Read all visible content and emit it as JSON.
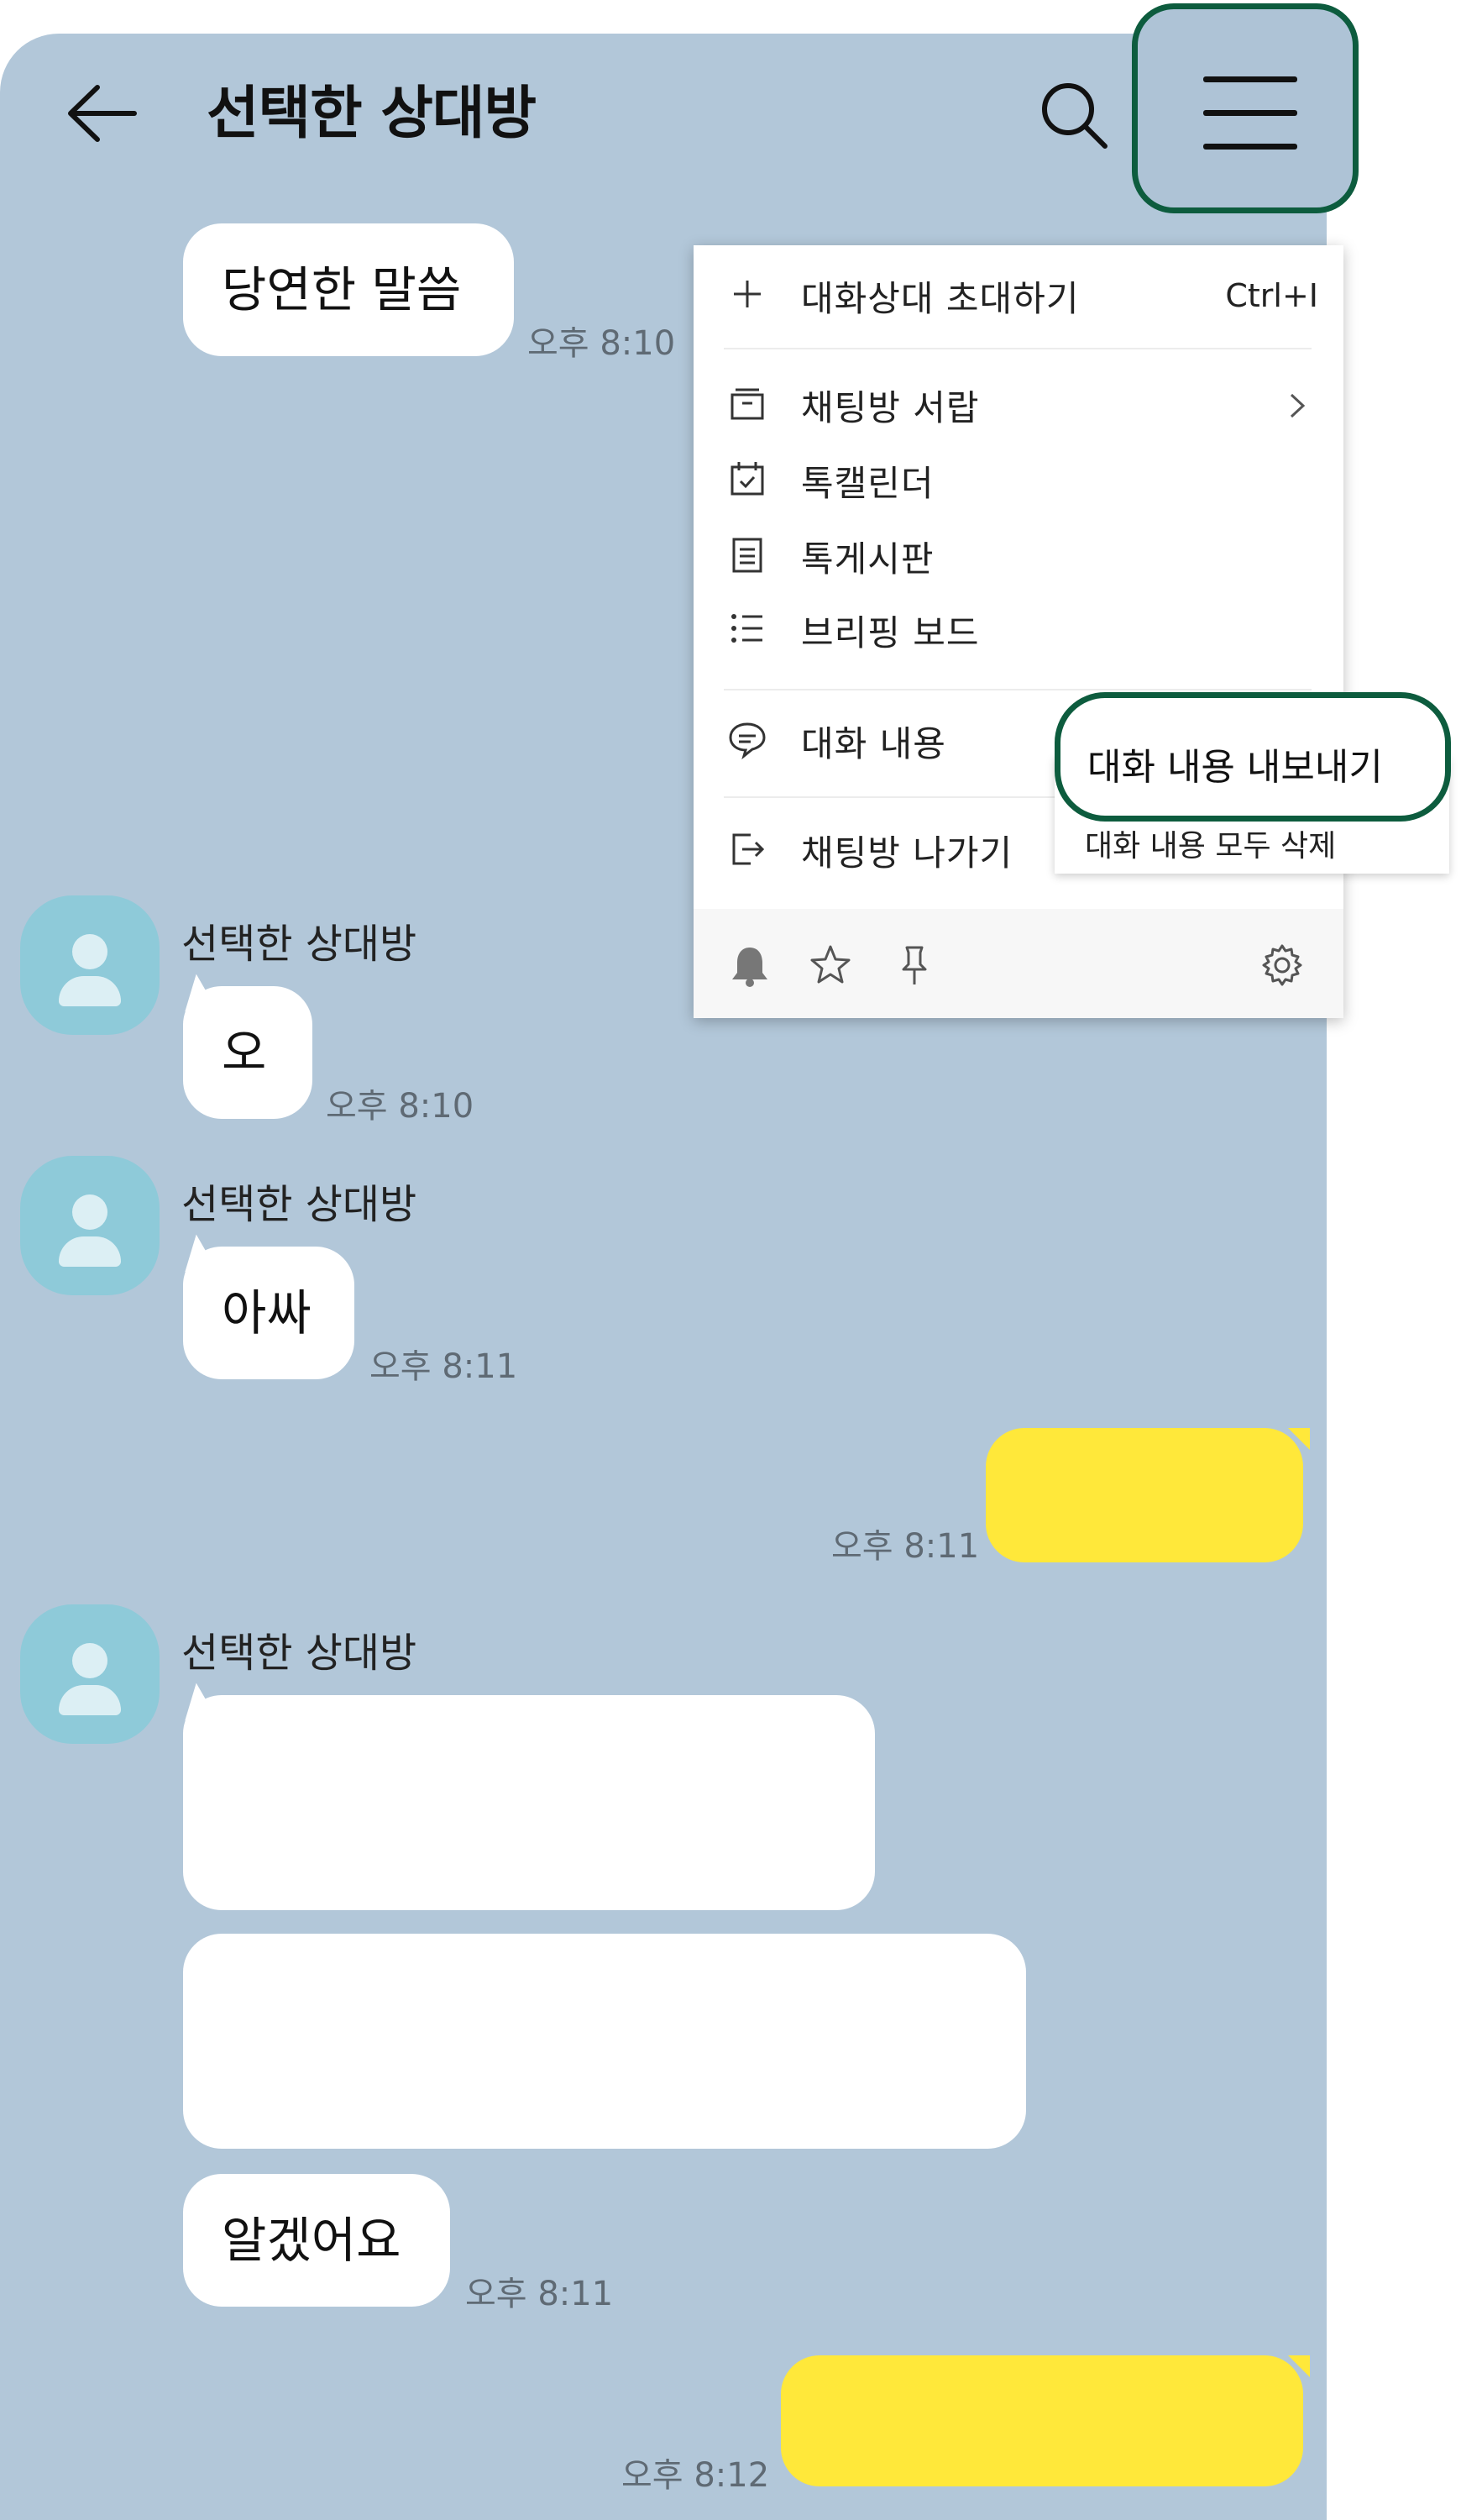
{
  "header": {
    "title": "선택한 상대방",
    "back_icon": "arrow-left-icon",
    "search_icon": "search-icon",
    "menu_icon": "hamburger-menu-icon"
  },
  "messages": [
    {
      "type": "received",
      "text": "당연한 말씀",
      "time": "오후 8:10"
    },
    {
      "type": "received",
      "sender": "선택한 상대방",
      "text": "오",
      "time": "오후 8:10"
    },
    {
      "type": "received",
      "sender": "선택한 상대방",
      "text": "아싸",
      "time": "오후 8:11"
    },
    {
      "type": "sent",
      "text": "",
      "time": "오후 8:11"
    },
    {
      "type": "received",
      "sender": "선택한 상대방",
      "text": "",
      "time": ""
    },
    {
      "type": "received",
      "text": "",
      "time": ""
    },
    {
      "type": "received",
      "text": "알겠어요",
      "time": "오후 8:11"
    },
    {
      "type": "sent",
      "text": "",
      "time": "오후 8:12"
    }
  ],
  "menu": {
    "invite": {
      "label": "대화상대 초대하기",
      "shortcut": "Ctrl+I"
    },
    "drawer": {
      "label": "채팅방 서랍"
    },
    "calendar": {
      "label": "톡캘린더"
    },
    "board": {
      "label": "톡게시판"
    },
    "briefing": {
      "label": "브리핑 보드"
    },
    "conversation": {
      "label": "대화 내용"
    },
    "leave": {
      "label": "채팅방 나가기"
    },
    "bottom_icons": [
      "bell-icon",
      "star-icon",
      "pin-icon",
      "gear-icon"
    ]
  },
  "submenu": {
    "export": "대화 내용 내보내기",
    "delete_all": "대화 내용 모두 삭제"
  },
  "colors": {
    "chat_bg": "#b2c7d9",
    "sent_bubble": "#ffe83a",
    "highlight": "#0d5c3e"
  }
}
